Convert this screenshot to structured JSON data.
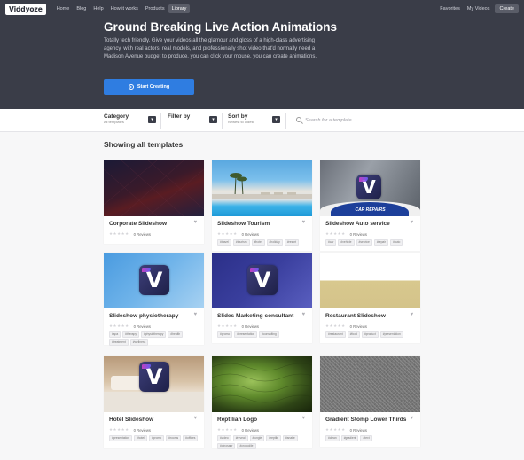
{
  "nav": {
    "logo": "Viddyoze",
    "left": [
      "Home",
      "Blog",
      "Help",
      "How it works",
      "Products",
      "Library"
    ],
    "active": "Library",
    "right": [
      "Favorites",
      "My Videos"
    ],
    "create": "Create"
  },
  "hero": {
    "title": "Ground Breaking Live Action Animations",
    "description": "Totally tech friendly. Give your videos all the glamour and gloss of a high-class advertising agency, with real actors, real models, and professionally shot video that'd normally need a Madison Avenue budget to produce, you can click your mouse, you can create animations.",
    "button": "Start Creating"
  },
  "filters": {
    "category_label": "Category",
    "category_value": "All templates",
    "filter_label": "Filter by",
    "sort_label": "Sort by",
    "sort_value": "Newest to oldest",
    "search_placeholder": "Search for a template..."
  },
  "showing": "Showing all templates",
  "templates": [
    {
      "title": "Corporate Slideshow",
      "reviews": "0 Reviews",
      "tags": []
    },
    {
      "title": "Slideshow Tourism",
      "reviews": "0 Reviews",
      "tags": [
        "#travel",
        "#tourism",
        "#hotel",
        "#holiday",
        "#resort"
      ]
    },
    {
      "title": "Slideshow Auto service",
      "reviews": "0 Reviews",
      "tags": [
        "#car",
        "#vehicle",
        "#service",
        "#repair",
        "#auto"
      ]
    },
    {
      "title": "Slideshow physiotherapy",
      "reviews": "0 Reviews",
      "tags": [
        "#spa",
        "#therapy",
        "#physiotherapy",
        "#health",
        "#treatment",
        "#wellness"
      ]
    },
    {
      "title": "Slides Marketing consultant",
      "reviews": "0 Reviews",
      "tags": [
        "#promo",
        "#presentation",
        "#consulting"
      ]
    },
    {
      "title": "Restaurant Slideshow",
      "reviews": "0 Reviews",
      "tags": [
        "#restaurant",
        "#food",
        "#product",
        "#presentation"
      ]
    },
    {
      "title": "Hotel Slideshow",
      "reviews": "0 Reviews",
      "tags": [
        "#presentation",
        "#hotel",
        "#promo",
        "#rooms",
        "#offices"
      ]
    },
    {
      "title": "Reptilian Logo",
      "reviews": "0 Reviews",
      "tags": [
        "#video",
        "#reveal",
        "#jungle",
        "#reptile",
        "#snake",
        "#dinosaur",
        "#crocodile"
      ]
    },
    {
      "title": "Gradient Stomp Lower Thirds",
      "reviews": "0 Reviews",
      "tags": [
        "#clean",
        "#gradient",
        "#text"
      ]
    }
  ],
  "thumb_labels": {
    "auto": "CAR REPAIRS"
  },
  "colors": {
    "nav_bg": "#3a3d48",
    "accent": "#2f7de1"
  },
  "icons": [
    "heart-icon",
    "search-icon",
    "chevron-down-icon",
    "play-circle-icon"
  ]
}
